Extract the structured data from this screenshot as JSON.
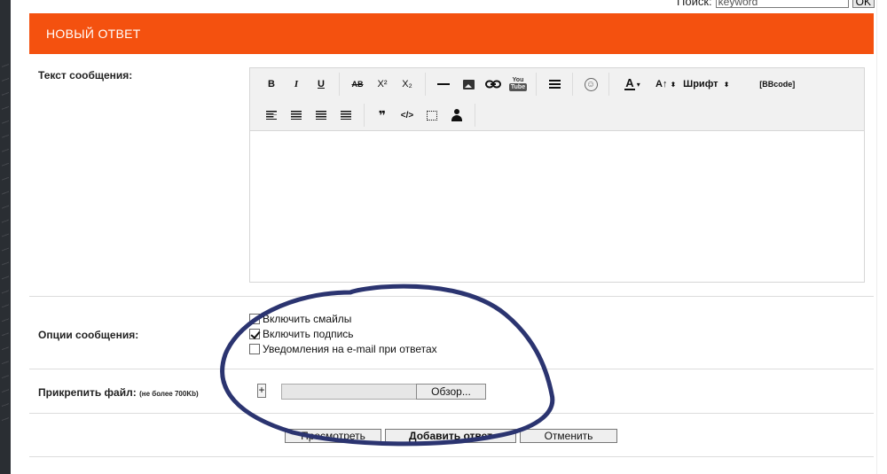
{
  "search": {
    "label": "Поиск:",
    "value": "keyword",
    "ok_label": "OK"
  },
  "header": {
    "title": "НОВЫЙ ОТВЕТ"
  },
  "colors": {
    "header_bg": "#f4510f",
    "annotation_stroke": "#2b3470"
  },
  "message": {
    "label": "Текст сообщения:",
    "toolbar": {
      "bold": "B",
      "italic": "I",
      "underline": "U",
      "strike": "AB",
      "superscript": "X²",
      "subscript": "X₂",
      "youtube_top": "You",
      "youtube_bottom": "Tube",
      "smiley": "☺",
      "font_color": "A",
      "font_size": "A↑",
      "font_family": "Шрифт",
      "bbcode": "[BBcode]",
      "quote": "❞",
      "code": "</>",
      "icons": [
        "bold-icon",
        "italic-icon",
        "underline-icon",
        "strikethrough-icon",
        "superscript-icon",
        "subscript-icon",
        "horizontal-rule-icon",
        "image-icon",
        "link-icon",
        "youtube-icon",
        "list-icon",
        "smiley-icon",
        "font-color-icon",
        "font-size-icon",
        "font-family-icon",
        "bbcode-icon",
        "align-left-icon",
        "align-center-icon",
        "align-right-icon",
        "align-justify-icon",
        "quote-icon",
        "code-icon",
        "box-icon",
        "user-icon"
      ]
    },
    "text": ""
  },
  "options": {
    "label": "Опции сообщения:",
    "items": [
      {
        "label": "Включить смайлы",
        "checked": false
      },
      {
        "label": "Включить подпись",
        "checked": true
      },
      {
        "label": "Уведомления на e-mail при ответах",
        "checked": false
      }
    ]
  },
  "attach": {
    "label": "Прикрепить файл:",
    "note": "(не более 700Kb)",
    "add_label": "+",
    "browse_label": "Обзор..."
  },
  "buttons": {
    "preview": "Просмотреть",
    "submit": "Добавить ответ",
    "cancel": "Отменить"
  }
}
